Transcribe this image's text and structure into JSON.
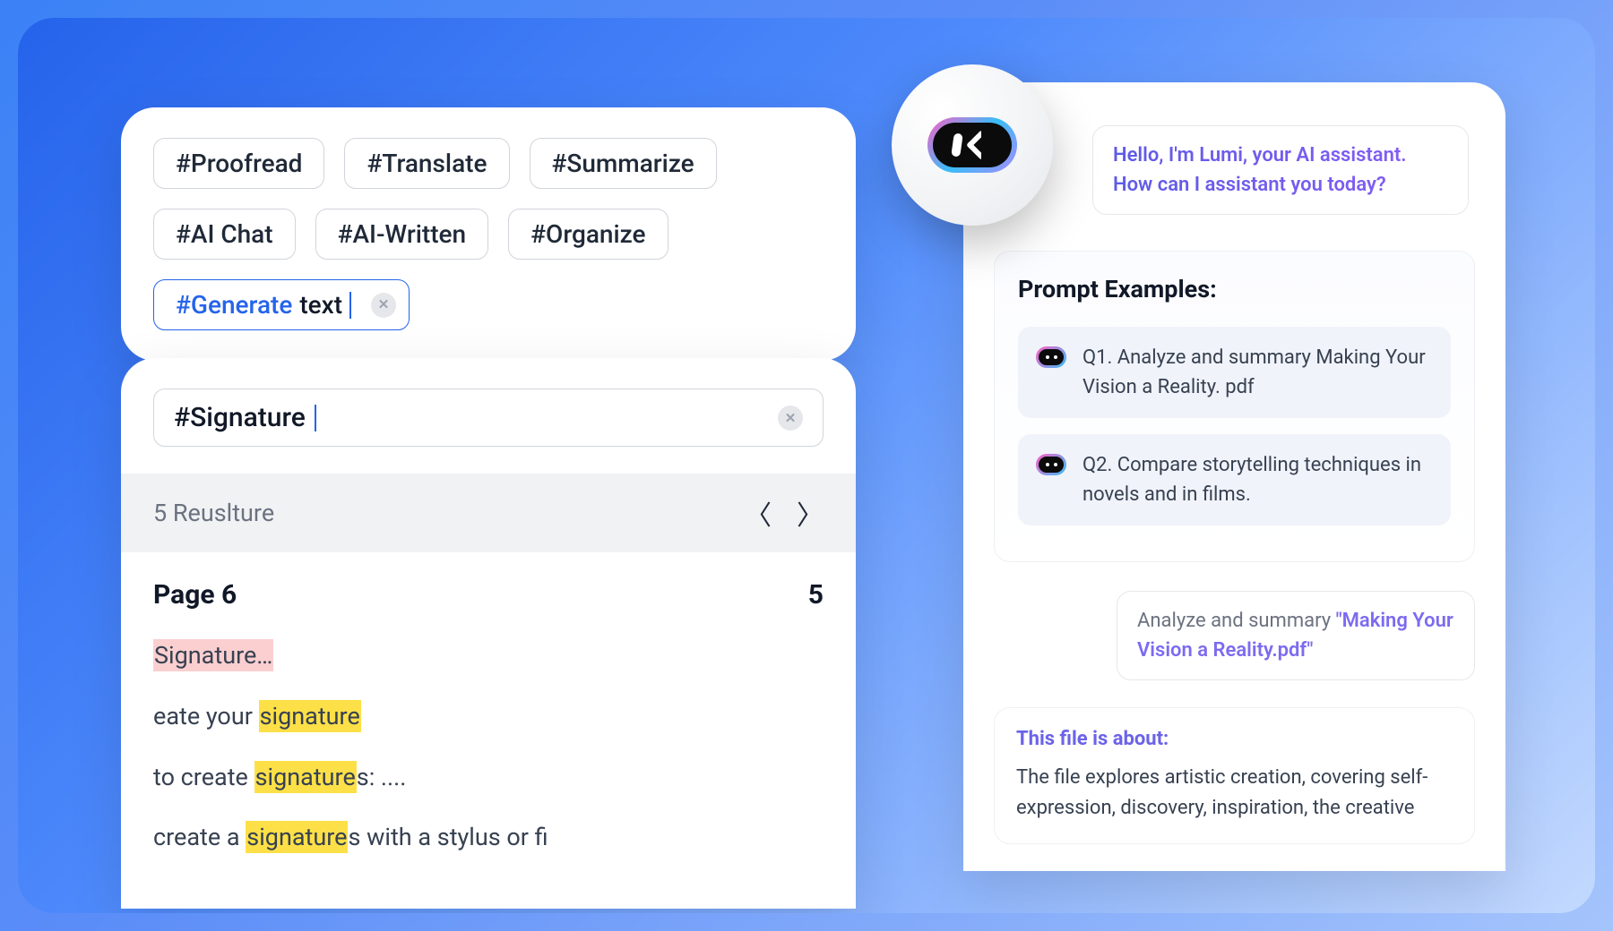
{
  "tags": {
    "t1": "#Proofread",
    "t2": "#Translate",
    "t3": "#Summarize",
    "t4": "#AI Chat",
    "t5": "#AI-Written",
    "t6": "#Organize",
    "active_cmd": "#Generate",
    "active_text": "text"
  },
  "search": {
    "query": "#Signature",
    "results_label": "5 Reuslture",
    "page_label": "Page 6",
    "page_count": "5"
  },
  "matches": {
    "m1_hl": "Signature…",
    "m2_pre": "eate your ",
    "m2_hl": "signature",
    "m3_pre": "to create ",
    "m3_hl": "signature",
    "m3_post": "s: ....",
    "m4_pre": "create a ",
    "m4_hl": "signature",
    "m4_post": "s with a stylus or fi"
  },
  "chat": {
    "greeting": "Hello, I'm Lumi, your AI assistant. How can I assistant you today?",
    "examples_title": "Prompt Examples:",
    "q1": "Q1. Analyze and summary Making Your Vision a Reality. pdf",
    "q2": "Q2. Compare storytelling techniques in novels and in films.",
    "user_pre": "Analyze and summary  ",
    "user_quoted": "\"Making Your Vision a Reality.pdf\"",
    "resp_title": "This file is about:",
    "resp_body": "The file explores artistic creation, covering self-expression, discovery, inspiration, the creative"
  }
}
